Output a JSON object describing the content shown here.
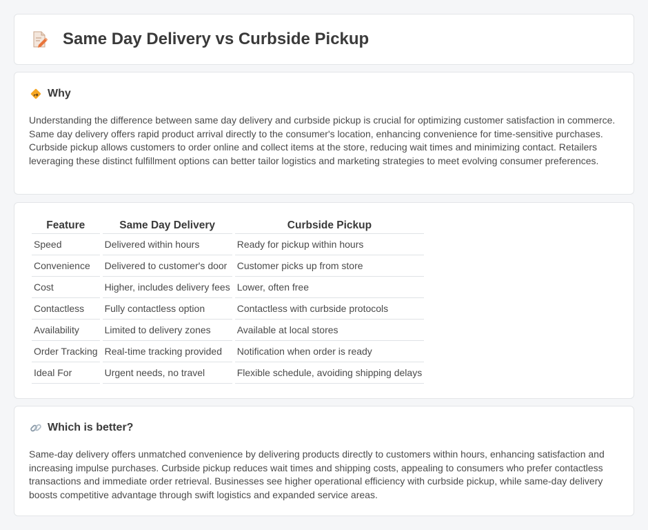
{
  "header": {
    "title": "Same Day Delivery vs Curbside Pickup",
    "icon": "document-pencil-icon"
  },
  "why": {
    "icon": "diamond-sign-icon",
    "title": "Why",
    "text": "Understanding the difference between same day delivery and curbside pickup is crucial for optimizing customer satisfaction in commerce. Same day delivery offers rapid product arrival directly to the consumer's location, enhancing convenience for time-sensitive purchases. Curbside pickup allows customers to order online and collect items at the store, reducing wait times and minimizing contact. Retailers leveraging these distinct fulfillment options can better tailor logistics and marketing strategies to meet evolving consumer preferences."
  },
  "table": {
    "headers": [
      "Feature",
      "Same Day Delivery",
      "Curbside Pickup"
    ],
    "rows": [
      [
        "Speed",
        "Delivered within hours",
        "Ready for pickup within hours"
      ],
      [
        "Convenience",
        "Delivered to customer's door",
        "Customer picks up from store"
      ],
      [
        "Cost",
        "Higher, includes delivery fees",
        "Lower, often free"
      ],
      [
        "Contactless",
        "Fully contactless option",
        "Contactless with curbside protocols"
      ],
      [
        "Availability",
        "Limited to delivery zones",
        "Available at local stores"
      ],
      [
        "Order Tracking",
        "Real-time tracking provided",
        "Notification when order is ready"
      ],
      [
        "Ideal For",
        "Urgent needs, no travel",
        "Flexible schedule, avoiding shipping delays"
      ]
    ]
  },
  "better": {
    "icon": "link-icon",
    "title": "Which is better?",
    "text": "Same-day delivery offers unmatched convenience by delivering products directly to customers within hours, enhancing satisfaction and increasing impulse purchases. Curbside pickup reduces wait times and shipping costs, appealing to consumers who prefer contactless transactions and immediate order retrieval. Businesses see higher operational efficiency with curbside pickup, while same-day delivery boosts competitive advantage through swift logistics and expanded service areas."
  }
}
